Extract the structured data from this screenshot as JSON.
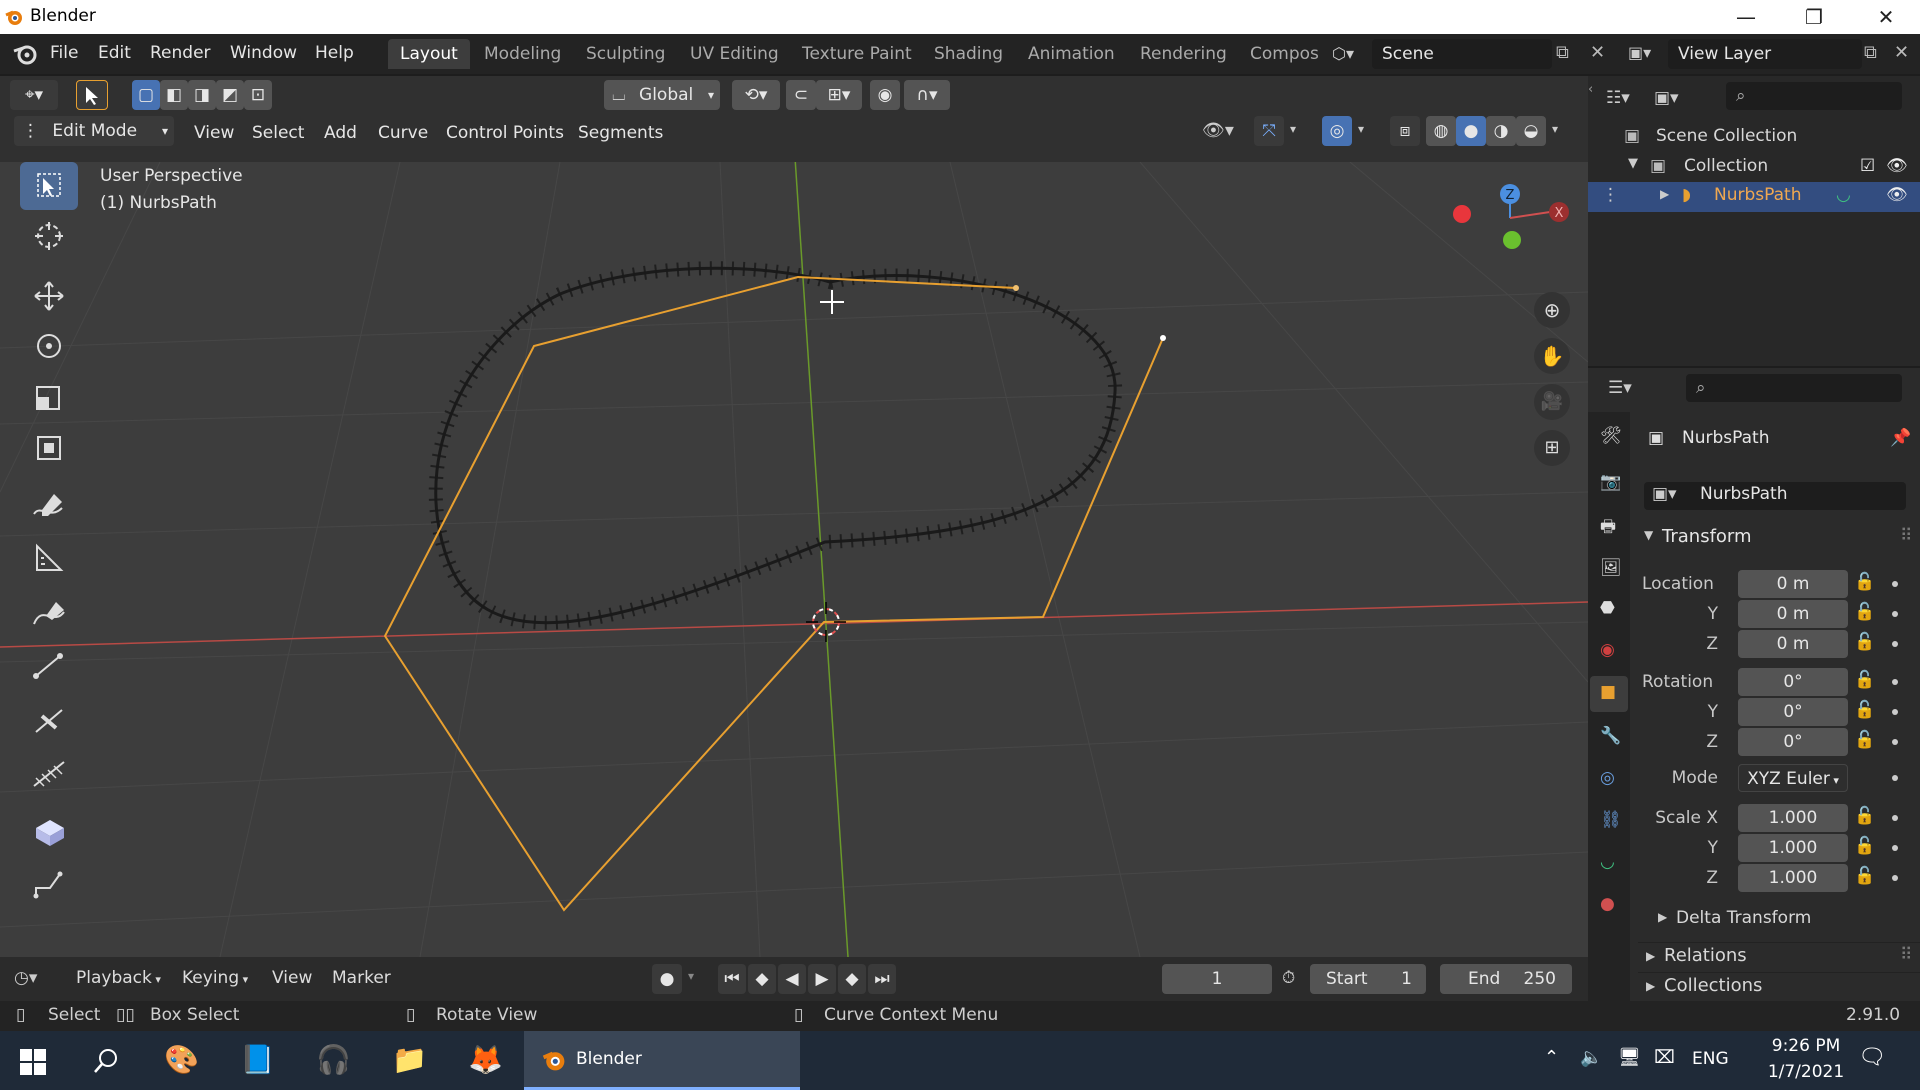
{
  "window": {
    "title": "Blender",
    "minimize": "—",
    "maximize": "❐",
    "close": "✕"
  },
  "menu": {
    "file": "File",
    "edit": "Edit",
    "render": "Render",
    "window": "Window",
    "help": "Help"
  },
  "workspaces": [
    {
      "label": "Layout",
      "active": true
    },
    {
      "label": "Modeling"
    },
    {
      "label": "Sculpting"
    },
    {
      "label": "UV Editing"
    },
    {
      "label": "Texture Paint"
    },
    {
      "label": "Shading"
    },
    {
      "label": "Animation"
    },
    {
      "label": "Rendering"
    },
    {
      "label": "Compos"
    }
  ],
  "scene": {
    "name": "Scene",
    "view_layer": "View Layer"
  },
  "viewport_header": {
    "orientation": "Global",
    "mode": "Edit Mode",
    "menus": [
      "View",
      "Select",
      "Add",
      "Curve",
      "Control Points",
      "Segments"
    ]
  },
  "viewport": {
    "perspective_label": "User Perspective",
    "object_label": "(1) NurbsPath"
  },
  "gizmo": {
    "z": "Z",
    "x": "X"
  },
  "outliner": {
    "scene_collection": "Scene Collection",
    "collection": "Collection",
    "object": "NurbsPath"
  },
  "properties": {
    "object_name": "NurbsPath",
    "data_name": "NurbsPath",
    "transform_header": "Transform",
    "location_label": "Location",
    "location": {
      "x": "0 m",
      "y": "0 m",
      "z": "0 m"
    },
    "rotation_label": "Rotation",
    "rotation": {
      "x": "0°",
      "y": "0°",
      "z": "0°"
    },
    "mode_label": "Mode",
    "mode_value": "XYZ Euler",
    "scale_label": "Scale X",
    "scale": {
      "x": "1.000",
      "y": "1.000",
      "z": "1.000"
    },
    "axis_y": "Y",
    "axis_z": "Z",
    "delta_transform": "Delta Transform",
    "relations": "Relations",
    "collections": "Collections"
  },
  "timeline": {
    "playback": "Playback",
    "keying": "Keying",
    "view": "View",
    "marker": "Marker",
    "current_frame": "1",
    "start_label": "Start",
    "start": "1",
    "end_label": "End",
    "end": "250"
  },
  "statusbar": {
    "select": "Select",
    "box_select": "Box Select",
    "rotate_view": "Rotate View",
    "context_menu": "Curve Context Menu",
    "version": "2.91.0"
  },
  "taskbar": {
    "active_app": "Blender",
    "language": "ENG",
    "time": "9:26 PM",
    "date": "1/7/2021"
  },
  "colors": {
    "accent_blue": "#4772b3",
    "curve_orange": "#f0a030",
    "x_axis": "#c0392b",
    "y_axis": "#7ab22a"
  }
}
